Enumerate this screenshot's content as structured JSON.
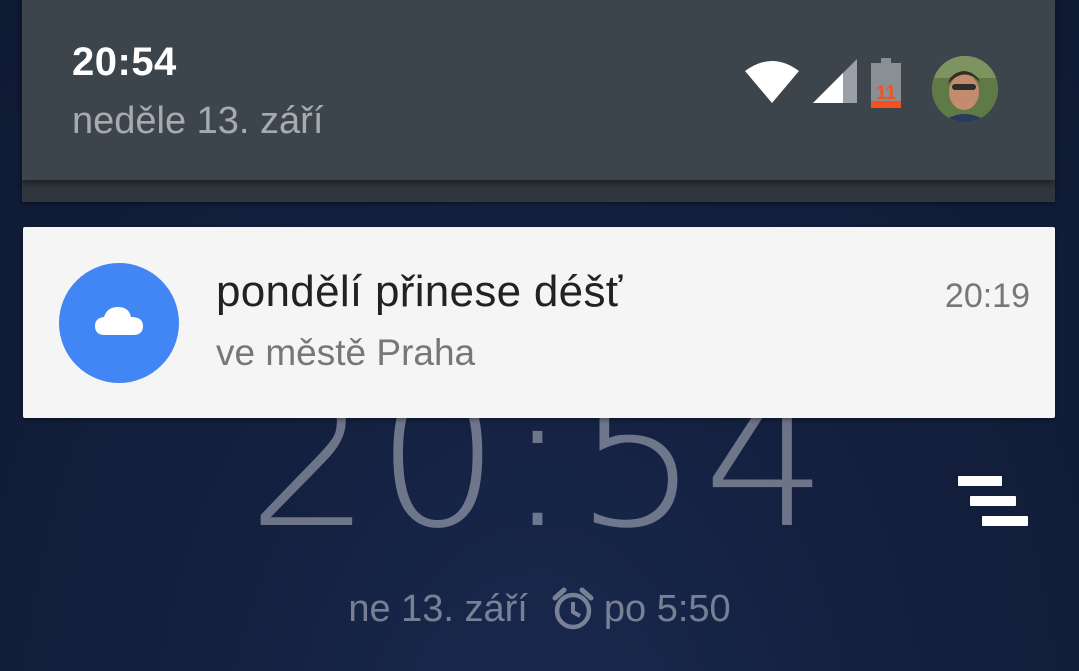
{
  "lockscreen": {
    "clock": "20:54",
    "date": "ne 13. září",
    "alarm": "po 5:50",
    "alarm_icon": "alarm-clock-icon",
    "stack_icon": "notification-stack-icon"
  },
  "shade": {
    "time": "20:54",
    "date": "neděle 13. září",
    "status": {
      "wifi_icon": "wifi-icon",
      "signal_icon": "cell-signal-icon",
      "battery_level": "11",
      "battery_color": "#f4511e"
    },
    "avatar_icon": "user-avatar"
  },
  "notification": {
    "title": "pondělí přinese déšť",
    "text": "ve městě Praha",
    "time": "20:19",
    "icon": "cloud-icon",
    "icon_bg": "#4285f4"
  }
}
